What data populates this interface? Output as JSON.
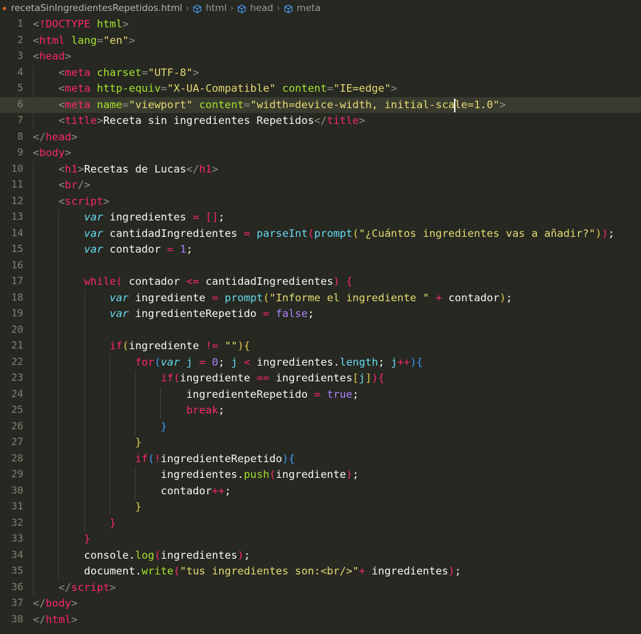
{
  "breadcrumb": {
    "modified_dot": true,
    "file": "recetaSinIngredientesRepetidos.html",
    "separator": "›",
    "items": [
      {
        "icon": "symbol-structure-icon",
        "label": "html"
      },
      {
        "icon": "symbol-structure-icon",
        "label": "head"
      },
      {
        "icon": "symbol-structure-icon",
        "label": "meta"
      }
    ]
  },
  "editor": {
    "active_line": 6,
    "cursor": {
      "line": 6,
      "column": 66
    },
    "total_lines": 38,
    "theme": {
      "background": "#262821",
      "active_line_background": "#393b2f",
      "gutter_foreground": "#7f8274",
      "cursor": "#f8f8f0",
      "tag": "#f92672",
      "attribute": "#a6e22e",
      "string": "#e6db74",
      "keyword": "#f92672",
      "variable_keyword": "#66d9ef",
      "number": "#ae81ff",
      "constant": "#ae81ff",
      "function": "#a6e22e",
      "builtin": "#66d9ef",
      "operator": "#f92672",
      "text": "#f8f8f2",
      "bracket_1": "#f92672",
      "bracket_2": "#e6c84a",
      "bracket_3": "#3b9dff",
      "indent_guide": "#3f4138"
    },
    "lines": [
      {
        "n": 1,
        "text": "<!DOCTYPE html>"
      },
      {
        "n": 2,
        "text": "<html lang=\"en\">"
      },
      {
        "n": 3,
        "text": "<head>"
      },
      {
        "n": 4,
        "text": "    <meta charset=\"UTF-8\">"
      },
      {
        "n": 5,
        "text": "    <meta http-equiv=\"X-UA-Compatible\" content=\"IE=edge\">"
      },
      {
        "n": 6,
        "text": "    <meta name=\"viewport\" content=\"width=device-width, initial-scale=1.0\">"
      },
      {
        "n": 7,
        "text": "    <title>Receta sin ingredientes Repetidos</title>"
      },
      {
        "n": 8,
        "text": "</head>"
      },
      {
        "n": 9,
        "text": "<body>"
      },
      {
        "n": 10,
        "text": "    <h1>Recetas de Lucas</h1>"
      },
      {
        "n": 11,
        "text": "    <br/>"
      },
      {
        "n": 12,
        "text": "    <script>"
      },
      {
        "n": 13,
        "text": "        var ingredientes = [];"
      },
      {
        "n": 14,
        "text": "        var cantidadIngredientes = parseInt(prompt(\"¿Cuántos ingredientes vas a añadir?\"));"
      },
      {
        "n": 15,
        "text": "        var contador = 1;"
      },
      {
        "n": 16,
        "text": ""
      },
      {
        "n": 17,
        "text": "        while( contador <= cantidadIngredientes) {"
      },
      {
        "n": 18,
        "text": "            var ingrediente = prompt(\"Informe el ingrediente \" + contador);"
      },
      {
        "n": 19,
        "text": "            var ingredienteRepetido = false;"
      },
      {
        "n": 20,
        "text": ""
      },
      {
        "n": 21,
        "text": "            if(ingrediente != \"\"){"
      },
      {
        "n": 22,
        "text": "                for(var j = 0; j < ingredientes.length; j++){"
      },
      {
        "n": 23,
        "text": "                    if(ingrediente == ingredientes[j]){"
      },
      {
        "n": 24,
        "text": "                        ingredienteRepetido = true;"
      },
      {
        "n": 25,
        "text": "                        break;"
      },
      {
        "n": 26,
        "text": "                    }"
      },
      {
        "n": 27,
        "text": "                }"
      },
      {
        "n": 28,
        "text": "                if(!ingredienteRepetido){"
      },
      {
        "n": 29,
        "text": "                    ingredientes.push(ingrediente);"
      },
      {
        "n": 30,
        "text": "                    contador++;"
      },
      {
        "n": 31,
        "text": "                }"
      },
      {
        "n": 32,
        "text": "            }"
      },
      {
        "n": 33,
        "text": "        }"
      },
      {
        "n": 34,
        "text": "        console.log(ingredientes);"
      },
      {
        "n": 35,
        "text": "        document.write(\"tus ingredientes son:<br/>\"+ ingredientes);"
      },
      {
        "n": 36,
        "text": "    </script>"
      },
      {
        "n": 37,
        "text": "</body>"
      },
      {
        "n": 38,
        "text": "</html>"
      }
    ]
  }
}
